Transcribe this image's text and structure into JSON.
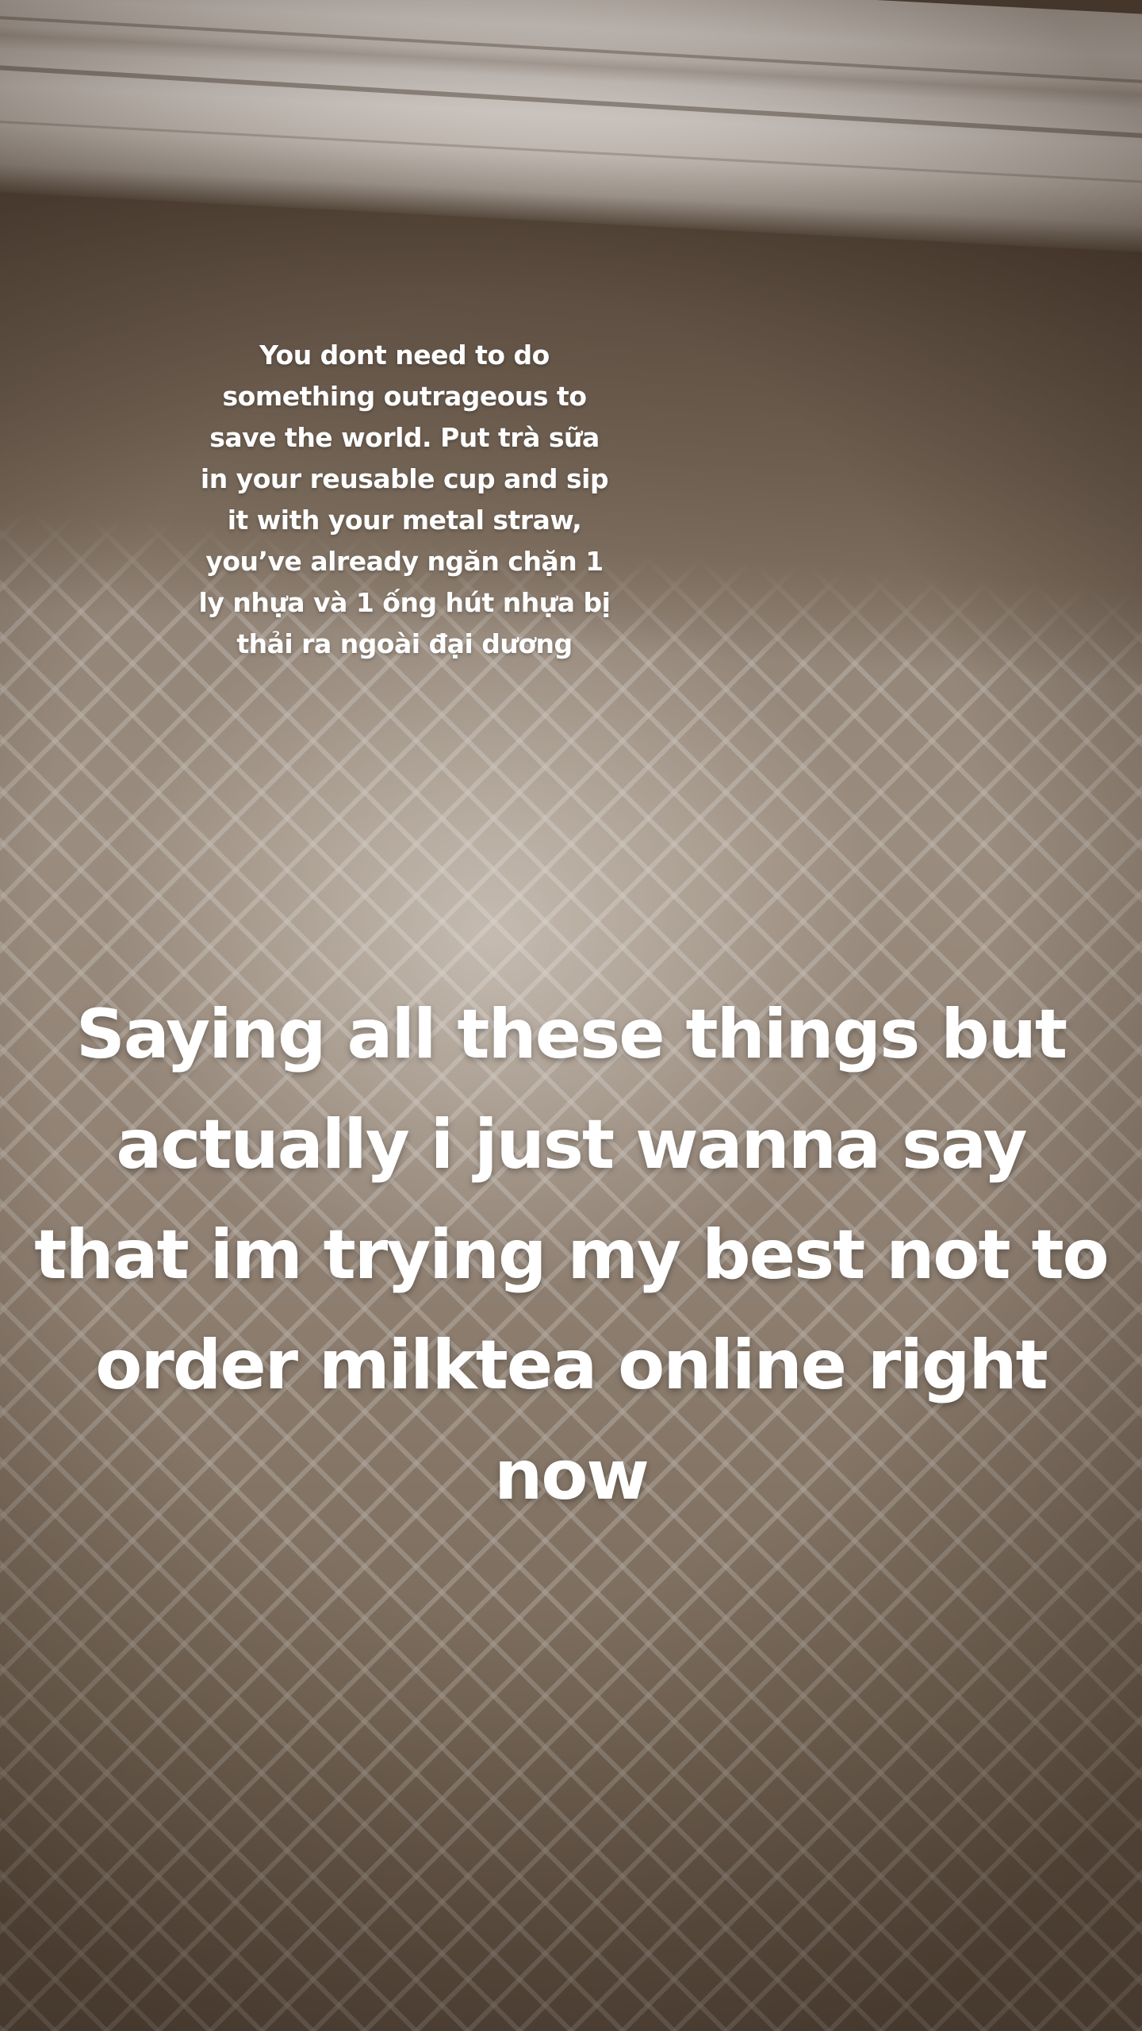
{
  "story": {
    "small_caption": "You dont need to do something outrageous to save the world. Put trà sữa in your reusable cup and sip it with your metal straw, you’ve already ngăn chặn 1 ly nhựa và 1 ống hút nhựa bị thải ra ngoài đại dương",
    "large_caption": "Saying all these things but actually i just wanna say that im trying my best not to order milktea online right now"
  },
  "colors": {
    "text": "#ffffff",
    "wall": "#8d7f72",
    "ceiling": "#e3ddd8",
    "shadow": "#4a3b2f"
  }
}
